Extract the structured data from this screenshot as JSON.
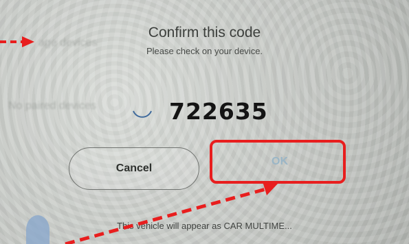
{
  "background": {
    "manage_devices": "age devices",
    "no_paired_devices": "No paired devices"
  },
  "dialog": {
    "title": "Confirm this code",
    "subtitle": "Please check on your device.",
    "code": "722635",
    "cancel_label": "Cancel",
    "ok_label": "OK",
    "footer": "This vehicle will appear as CAR MULTIME..."
  },
  "icons": {
    "spinner": "spinner-icon",
    "avatar": "user-avatar-icon"
  },
  "colors": {
    "annotation": "#e81e1e",
    "ok_text": "#9ab6c7",
    "spinner": "#3f6a9c"
  }
}
